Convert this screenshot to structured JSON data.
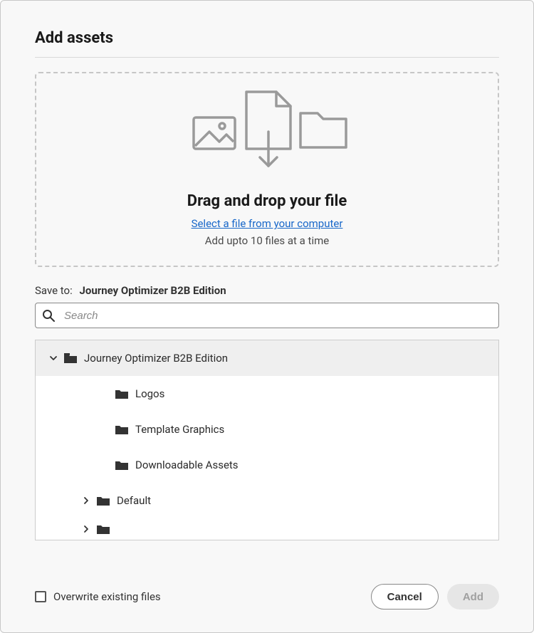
{
  "dialog": {
    "title": "Add assets"
  },
  "dropzone": {
    "heading": "Drag and drop your file",
    "link": "Select a file from your computer",
    "hint": "Add upto 10 files at a time"
  },
  "saveTo": {
    "label": "Save to:",
    "value": "Journey Optimizer B2B Edition"
  },
  "search": {
    "placeholder": "Search"
  },
  "tree": {
    "root": {
      "label": "Journey Optimizer B2B Edition",
      "expanded": true,
      "children": [
        {
          "label": "Logos"
        },
        {
          "label": "Template Graphics"
        },
        {
          "label": "Downloadable Assets"
        }
      ]
    },
    "siblings": [
      {
        "label": "Default",
        "expanded": false
      }
    ]
  },
  "footer": {
    "overwriteLabel": "Overwrite existing files",
    "cancel": "Cancel",
    "add": "Add"
  }
}
